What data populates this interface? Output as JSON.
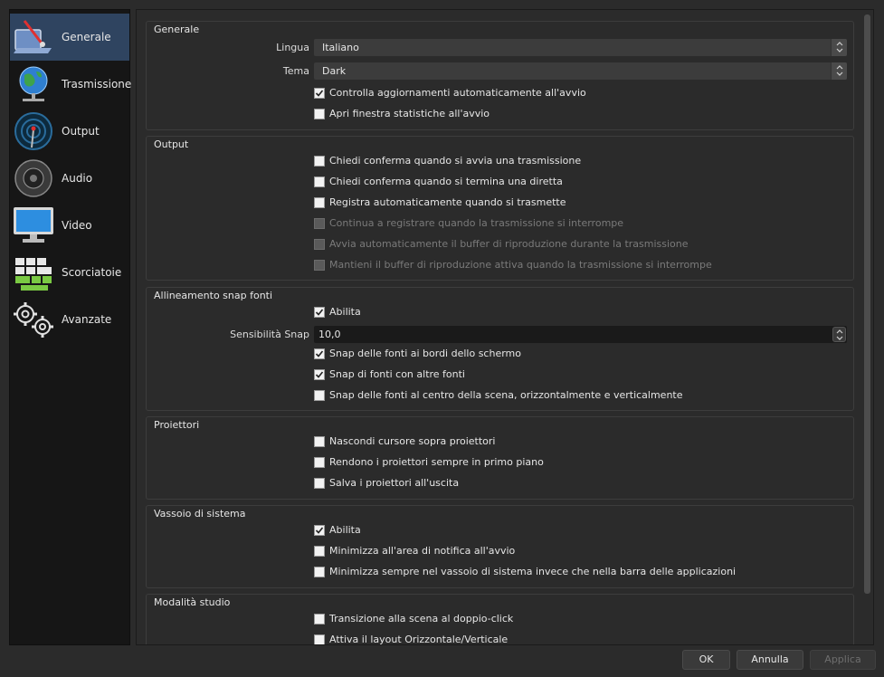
{
  "sidebar": {
    "items": [
      {
        "label": "Generale",
        "icon": "generale-icon",
        "selected": true
      },
      {
        "label": "Trasmissione",
        "icon": "globe-icon",
        "selected": false
      },
      {
        "label": "Output",
        "icon": "output-antenna-icon",
        "selected": false
      },
      {
        "label": "Audio",
        "icon": "speaker-icon",
        "selected": false
      },
      {
        "label": "Video",
        "icon": "monitor-icon",
        "selected": false
      },
      {
        "label": "Scorciatoie",
        "icon": "keyboard-icon",
        "selected": false
      },
      {
        "label": "Avanzate",
        "icon": "gears-icon",
        "selected": false
      }
    ]
  },
  "generale": {
    "title": "Generale",
    "lingua_label": "Lingua",
    "lingua_value": "Italiano",
    "tema_label": "Tema",
    "tema_value": "Dark",
    "check_aggiornamenti": "Controlla aggiornamenti automaticamente all'avvio",
    "check_aggiornamenti_checked": true,
    "check_statistiche": "Apri finestra statistiche all'avvio",
    "check_statistiche_checked": false
  },
  "output": {
    "title": "Output",
    "items": [
      {
        "label": "Chiedi conferma quando si avvia una trasmissione",
        "checked": false,
        "disabled": false
      },
      {
        "label": "Chiedi conferma quando si termina una diretta",
        "checked": false,
        "disabled": false
      },
      {
        "label": "Registra automaticamente quando si trasmette",
        "checked": false,
        "disabled": false
      },
      {
        "label": "Continua a registrare quando la trasmissione si interrompe",
        "checked": false,
        "disabled": true
      },
      {
        "label": "Avvia automaticamente il buffer di riproduzione durante la trasmissione",
        "checked": false,
        "disabled": true
      },
      {
        "label": "Mantieni il buffer di riproduzione attiva quando la trasmissione si interrompe",
        "checked": false,
        "disabled": true
      }
    ]
  },
  "snap": {
    "title": "Allineamento snap fonti",
    "abilita": "Abilita",
    "abilita_checked": true,
    "sensibilita_label": "Sensibilità Snap",
    "sensibilita_value": "10,0",
    "items": [
      {
        "label": "Snap delle fonti ai bordi dello schermo",
        "checked": true
      },
      {
        "label": "Snap di fonti con altre fonti",
        "checked": true
      },
      {
        "label": "Snap delle fonti al centro della scena, orizzontalmente e verticalmente",
        "checked": false
      }
    ]
  },
  "proiettori": {
    "title": "Proiettori",
    "items": [
      {
        "label": "Nascondi cursore sopra proiettori",
        "checked": false
      },
      {
        "label": "Rendono i proiettori sempre in primo piano",
        "checked": false
      },
      {
        "label": "Salva i proiettori all'uscita",
        "checked": false
      }
    ]
  },
  "vassoio": {
    "title": "Vassoio di sistema",
    "items": [
      {
        "label": "Abilita",
        "checked": true
      },
      {
        "label": "Minimizza all'area di notifica all'avvio",
        "checked": false
      },
      {
        "label": "Minimizza sempre nel vassoio di sistema invece che nella barra delle applicazioni",
        "checked": false
      }
    ]
  },
  "studio": {
    "title": "Modalità studio",
    "items": [
      {
        "label": "Transizione alla scena al doppio-click",
        "checked": false
      },
      {
        "label": "Attiva il layout Orizzontale/Verticale",
        "checked": false
      }
    ]
  },
  "buttons": {
    "ok": "OK",
    "annulla": "Annulla",
    "applica": "Applica"
  },
  "colors": {
    "selected_bg": "#2f4460",
    "panel_bg": "#2b2b2b",
    "sidebar_bg": "#161616"
  }
}
